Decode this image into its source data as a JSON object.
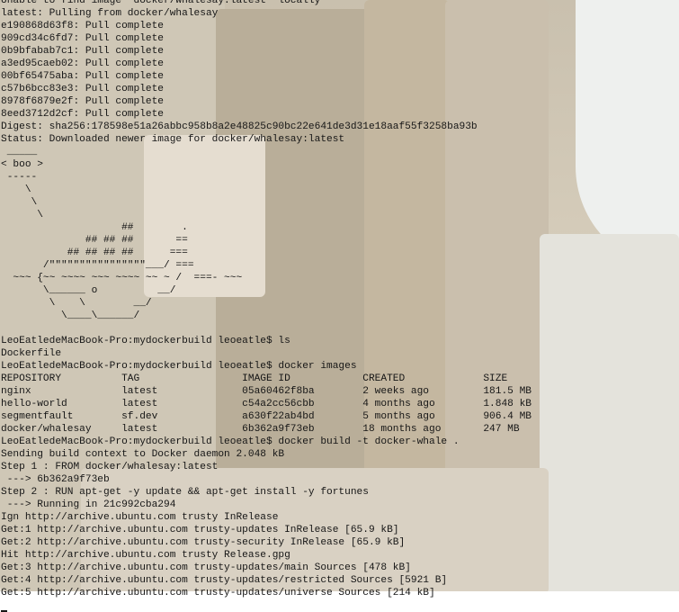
{
  "terminal": {
    "lines": [
      "Unable to find image 'docker/whalesay:latest' locally",
      "latest: Pulling from docker/whalesay",
      "e190868d63f8: Pull complete",
      "909cd34c6fd7: Pull complete",
      "0b9bfabab7c1: Pull complete",
      "a3ed95caeb02: Pull complete",
      "00bf65475aba: Pull complete",
      "c57b6bcc83e3: Pull complete",
      "8978f6879e2f: Pull complete",
      "8eed3712d2cf: Pull complete",
      "Digest: sha256:178598e51a26abbc958b8a2e48825c90bc22e641de3d31e18aaf55f3258ba93b",
      "Status: Downloaded newer image for docker/whalesay:latest",
      " _____",
      "< boo >",
      " -----",
      "    \\",
      "     \\",
      "      \\",
      "                    ##        .",
      "              ## ## ##       ==",
      "           ## ## ## ##      ===",
      "       /\"\"\"\"\"\"\"\"\"\"\"\"\"\"\"\"___/ ===",
      "  ~~~ {~~ ~~~~ ~~~ ~~~~ ~~ ~ /  ===- ~~~",
      "       \\______ o          __/",
      "        \\    \\        __/",
      "          \\____\\______/",
      "",
      "LeoEatledeMacBook-Pro:mydockerbuild leoeatle$ ls",
      "Dockerfile",
      "LeoEatledeMacBook-Pro:mydockerbuild leoeatle$ docker images",
      "REPOSITORY          TAG                 IMAGE ID            CREATED             SIZE",
      "nginx               latest              05a60462f8ba        2 weeks ago         181.5 MB",
      "hello-world         latest              c54a2cc56cbb        4 months ago        1.848 kB",
      "segmentfault        sf.dev              a630f22ab4bd        5 months ago        906.4 MB",
      "docker/whalesay     latest              6b362a9f73eb        18 months ago       247 MB",
      "LeoEatledeMacBook-Pro:mydockerbuild leoeatle$ docker build -t docker-whale .",
      "Sending build context to Docker daemon 2.048 kB",
      "Step 1 : FROM docker/whalesay:latest",
      " ---> 6b362a9f73eb",
      "Step 2 : RUN apt-get -y update && apt-get install -y fortunes",
      " ---> Running in 21c992cba294",
      "Ign http://archive.ubuntu.com trusty InRelease",
      "Get:1 http://archive.ubuntu.com trusty-updates InRelease [65.9 kB]",
      "Get:2 http://archive.ubuntu.com trusty-security InRelease [65.9 kB]",
      "Hit http://archive.ubuntu.com trusty Release.gpg",
      "Get:3 http://archive.ubuntu.com trusty-updates/main Sources [478 kB]",
      "Get:4 http://archive.ubuntu.com trusty-updates/restricted Sources [5921 B]",
      "Get:5 http://archive.ubuntu.com trusty-updates/universe Sources [214 kB]"
    ]
  },
  "colors": {
    "text": "#161616"
  }
}
